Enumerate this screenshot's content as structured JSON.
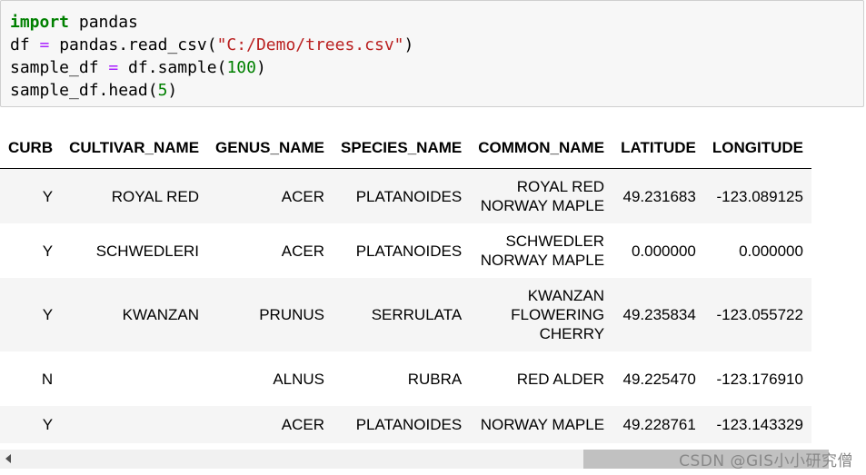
{
  "code_cell": {
    "lines": [
      [
        {
          "t": "import",
          "c": "kw"
        },
        {
          "t": " pandas",
          "c": ""
        }
      ],
      [
        {
          "t": "df ",
          "c": ""
        },
        {
          "t": "=",
          "c": "op"
        },
        {
          "t": " pandas.read_csv(",
          "c": ""
        },
        {
          "t": "\"C:/Demo/trees.csv\"",
          "c": "str"
        },
        {
          "t": ")",
          "c": ""
        }
      ],
      [
        {
          "t": "sample_df ",
          "c": ""
        },
        {
          "t": "=",
          "c": "op"
        },
        {
          "t": " df.sample(",
          "c": ""
        },
        {
          "t": "100",
          "c": "num"
        },
        {
          "t": ")",
          "c": ""
        }
      ],
      [
        {
          "t": "sample_df.head(",
          "c": ""
        },
        {
          "t": "5",
          "c": "num"
        },
        {
          "t": ")",
          "c": ""
        }
      ]
    ]
  },
  "table": {
    "columns": [
      "CURB",
      "CULTIVAR_NAME",
      "GENUS_NAME",
      "SPECIES_NAME",
      "COMMON_NAME",
      "LATITUDE",
      "LONGITUDE"
    ],
    "rows": [
      {
        "cells": [
          "Y",
          "ROYAL RED",
          "ACER",
          "PLATANOIDES",
          [
            "ROYAL RED",
            "NORWAY MAPLE"
          ],
          "49.231683",
          "-123.089125"
        ]
      },
      {
        "cells": [
          "Y",
          "SCHWEDLERI",
          "ACER",
          "PLATANOIDES",
          [
            "SCHWEDLER",
            "NORWAY MAPLE"
          ],
          "0.000000",
          "0.000000"
        ]
      },
      {
        "cells": [
          "Y",
          "KWANZAN",
          "PRUNUS",
          "SERRULATA",
          [
            "KWANZAN",
            "FLOWERING",
            "CHERRY"
          ],
          "49.235834",
          "-123.055722"
        ]
      },
      {
        "cells": [
          "N",
          "",
          "ALNUS",
          "RUBRA",
          [
            "RED ALDER"
          ],
          "49.225470",
          "-123.176910"
        ]
      },
      {
        "cells": [
          "Y",
          "",
          "ACER",
          "PLATANOIDES",
          [
            "NORWAY MAPLE"
          ],
          "49.228761",
          "-123.143329"
        ]
      }
    ]
  },
  "watermark": "CSDN @GIS小小研究僧"
}
